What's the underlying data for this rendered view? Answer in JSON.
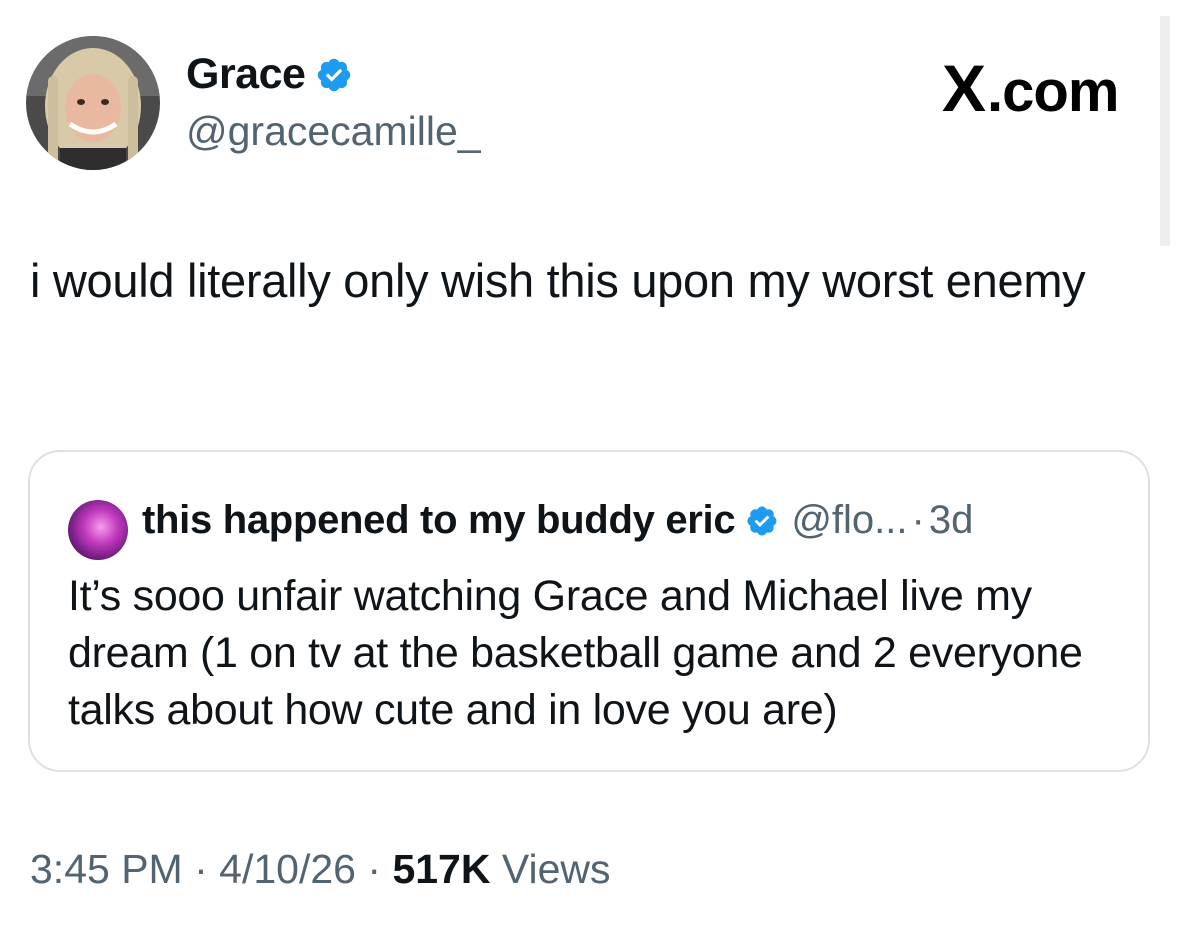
{
  "author": {
    "name": "Grace",
    "handle": "@gracecamille_",
    "avatar_icon": "profile-photo",
    "verified_icon": "verified-badge-icon",
    "verified_color": "#1d9bf0"
  },
  "brand": {
    "label": ".com",
    "mark": "X"
  },
  "tweet": {
    "text": "i would literally only wish this upon my worst enemy"
  },
  "quoted_tweet": {
    "author_name": "this happened to my buddy eric",
    "handle": "@flo...",
    "separator": "·",
    "time": "3d",
    "text": "It’s sooo unfair watching Grace and Michael live my dream (1 on tv at the basketball game and 2 everyone talks about how cute and in love you are)"
  },
  "meta": {
    "time": "3:45 PM",
    "separator": "·",
    "date": "4/10/26",
    "views_count": "517K",
    "views_label": "Views"
  },
  "colors": {
    "text": "#0f1419",
    "secondary": "#536471",
    "border": "#dbe1e6"
  }
}
